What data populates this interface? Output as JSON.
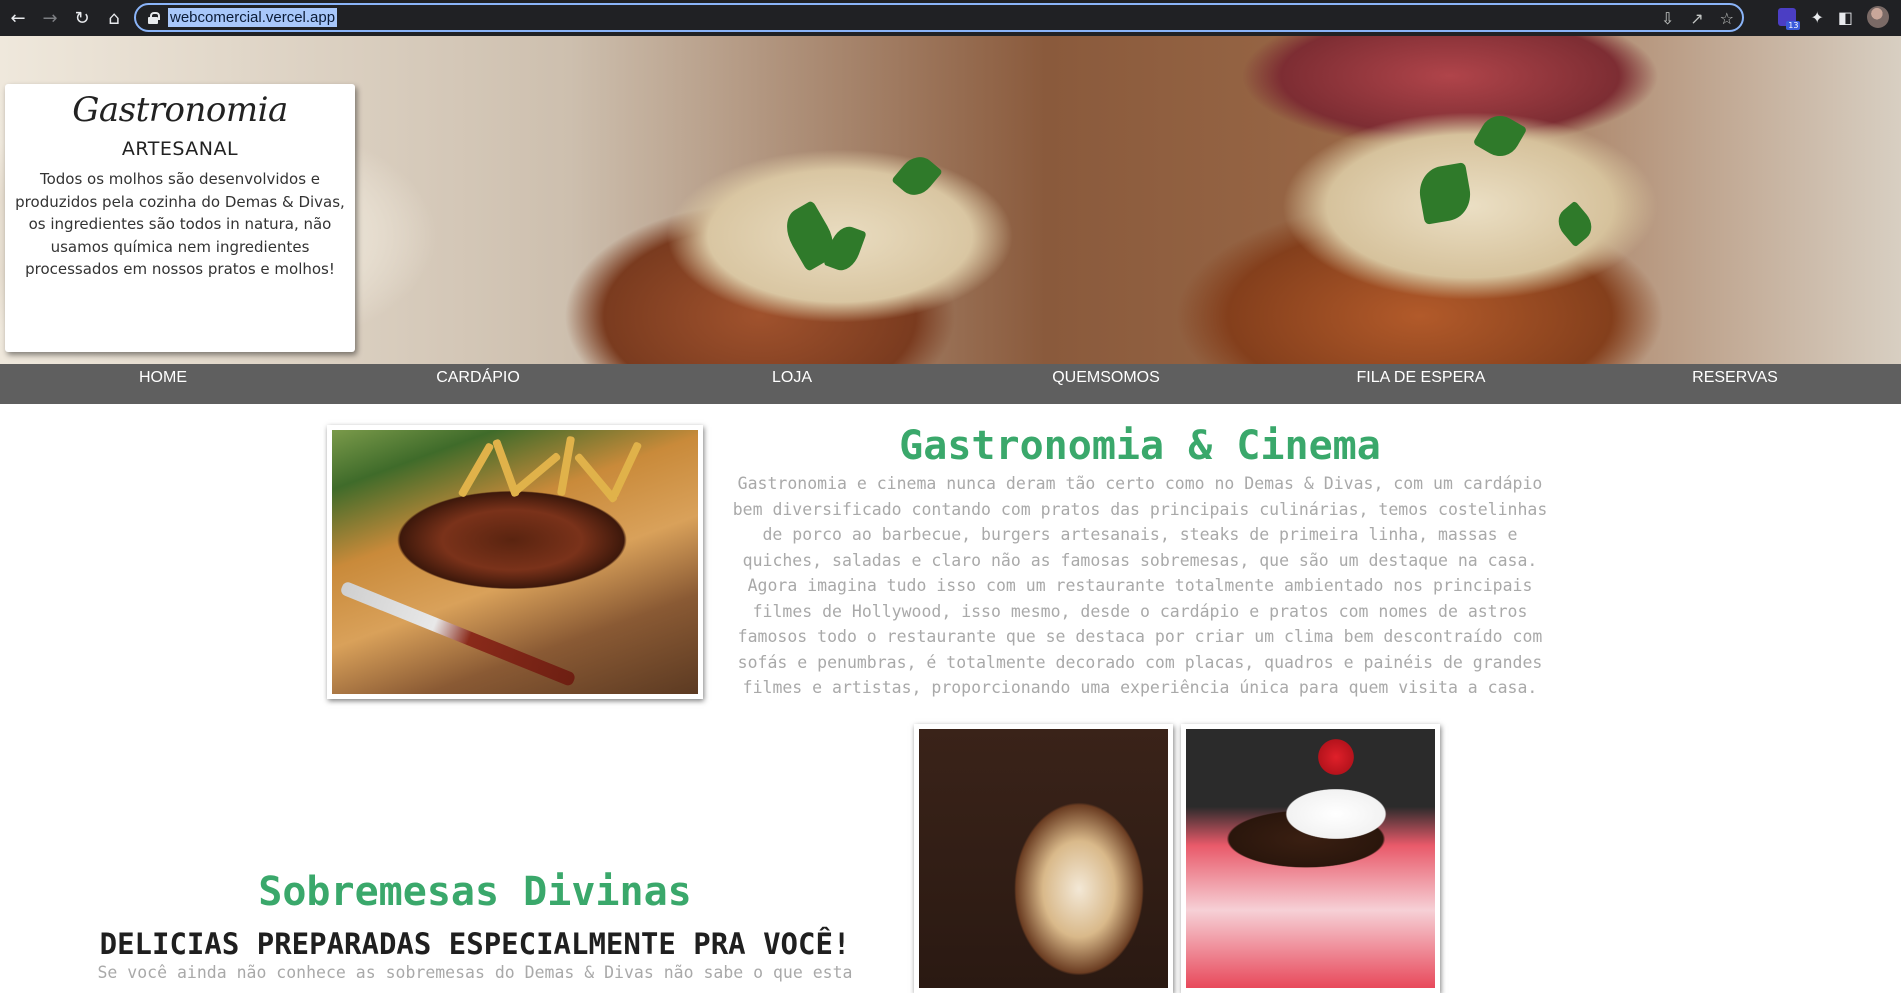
{
  "browser": {
    "url": "webcomercial.vercel.app",
    "extension_badge": "13"
  },
  "hero_card": {
    "script_title": "Gastronomia",
    "subtitle": "ARTESANAL",
    "text": "Todos os molhos são desenvolvidos e produzidos pela cozinha do Demas & Divas, os ingredientes são todos in natura, não usamos química nem ingredientes processados em nossos pratos e molhos!"
  },
  "menu": {
    "items": [
      {
        "label": "HOME"
      },
      {
        "label": "CARDÁPIO"
      },
      {
        "label": "LOJA"
      },
      {
        "label": "QUEMSOMOS"
      },
      {
        "label": "FILA DE ESPERA"
      },
      {
        "label": "RESERVAS"
      }
    ]
  },
  "section1": {
    "title": "Gastronomia & Cinema",
    "text": "Gastronomia e cinema nunca deram tão certo como no Demas & Divas, com um cardápio bem diversificado contando com pratos das principais culinárias, temos costelinhas de porco ao barbecue, burgers artesanais, steaks de primeira linha, massas e quiches, saladas e claro não as famosas sobremesas, que são um destaque na casa. Agora imagina tudo isso com um restaurante totalmente ambientado nos principais filmes de Hollywood, isso mesmo, desde o cardápio e pratos com nomes de astros famosos todo o restaurante que se destaca por criar um clima bem descontraído com sofás e penumbras, é totalmente decorado com placas, quadros e painéis de grandes filmes e artistas, proporcionando uma experiência única para quem visita a casa."
  },
  "section2": {
    "title": "Sobremesas Divinas",
    "subtitle": "DELICIAS PREPARADAS ESPECIALMENTE PRA VOCÊ!",
    "text": "Se você ainda não conhece as sobremesas do Demas & Divas não sabe o que esta"
  },
  "colors": {
    "accent_green": "#3aa86b",
    "menu_bg": "#5f5f5f",
    "browser_bg": "#202124"
  }
}
